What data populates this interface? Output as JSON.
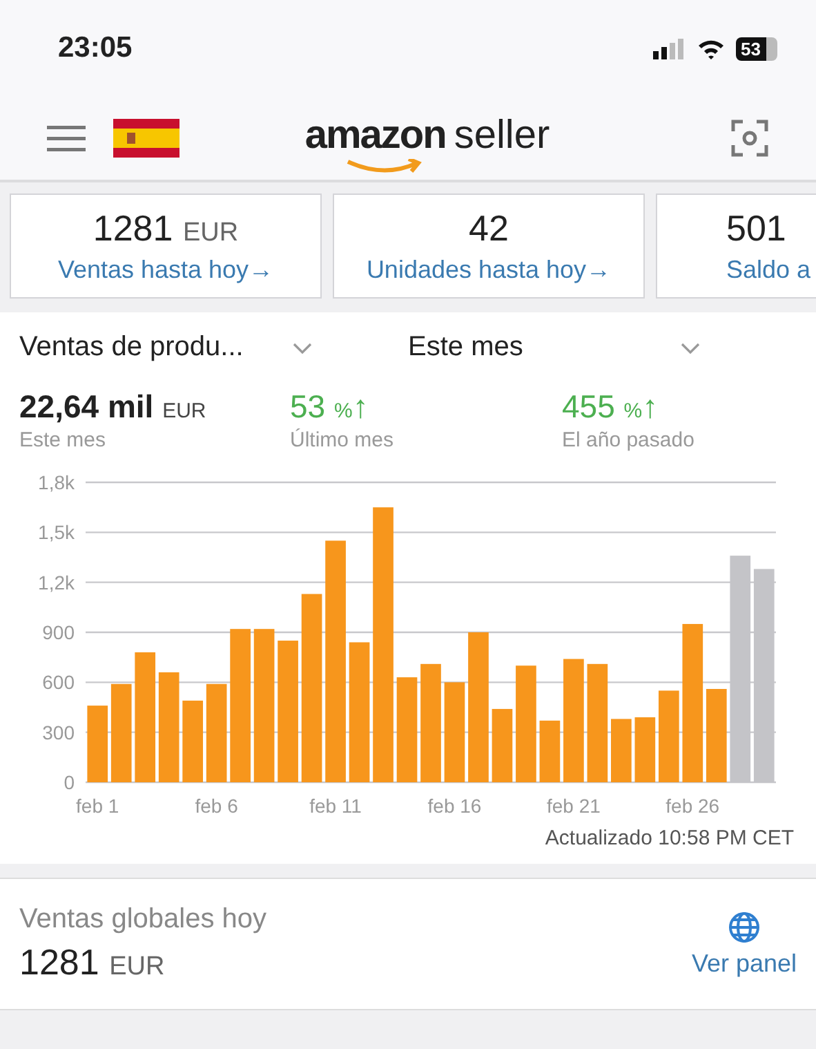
{
  "status_bar": {
    "time": "23:05",
    "battery": "53"
  },
  "header": {
    "logo_brand": "amazon",
    "logo_suffix": "seller"
  },
  "summary_cards": [
    {
      "value": "1281",
      "unit": "EUR",
      "link": "Ventas hasta hoy",
      "arrow": "→"
    },
    {
      "value": "42",
      "link": "Unidades hasta hoy",
      "arrow": "→"
    },
    {
      "value": "501",
      "link": "Saldo a"
    }
  ],
  "sales_panel": {
    "metric_dropdown": "Ventas de produ...",
    "period_dropdown": "Este mes",
    "stats": [
      {
        "value": "22,64 mil",
        "unit": "EUR",
        "label": "Este mes",
        "kind": "total"
      },
      {
        "value": "53",
        "unit": "%",
        "arrow": "↑",
        "label": "Último mes",
        "kind": "change"
      },
      {
        "value": "455",
        "unit": "%",
        "arrow": "↑",
        "label": "El año pasado",
        "kind": "change"
      }
    ],
    "chart_data": {
      "type": "bar",
      "grid": true,
      "categories": [
        "feb 1",
        null,
        null,
        null,
        null,
        "feb 6",
        null,
        null,
        null,
        null,
        "feb 11",
        null,
        null,
        null,
        null,
        "feb 16",
        null,
        null,
        null,
        null,
        "feb 21",
        null,
        null,
        null,
        null,
        "feb 26",
        null,
        null,
        null
      ],
      "ylim": [
        0,
        1800
      ],
      "yticks": [
        {
          "value": 0,
          "label": "0"
        },
        {
          "value": 300,
          "label": "300"
        },
        {
          "value": 600,
          "label": "600"
        },
        {
          "value": 900,
          "label": "900"
        },
        {
          "value": 1200,
          "label": "1,2k"
        },
        {
          "value": 1500,
          "label": "1,5k"
        },
        {
          "value": 1800,
          "label": "1,8k"
        }
      ],
      "series": [
        {
          "color": "#f7961c",
          "values": [
            460,
            590,
            780,
            660,
            490,
            590,
            920,
            920,
            850,
            1130,
            1450,
            840,
            1650,
            630,
            710,
            600,
            900,
            440,
            700,
            370,
            740,
            710,
            380,
            390,
            550,
            950,
            560,
            null,
            null
          ]
        },
        {
          "color": "#c4c4c8",
          "values": [
            null,
            null,
            null,
            null,
            null,
            null,
            null,
            null,
            null,
            null,
            null,
            null,
            null,
            null,
            null,
            null,
            null,
            null,
            null,
            null,
            null,
            null,
            null,
            null,
            null,
            null,
            null,
            1360,
            1280
          ]
        }
      ]
    },
    "updated": "Actualizado 10:58 PM CET"
  },
  "global_sales": {
    "title": "Ventas globales hoy",
    "value": "1281",
    "unit": "EUR",
    "link": "Ver panel"
  }
}
